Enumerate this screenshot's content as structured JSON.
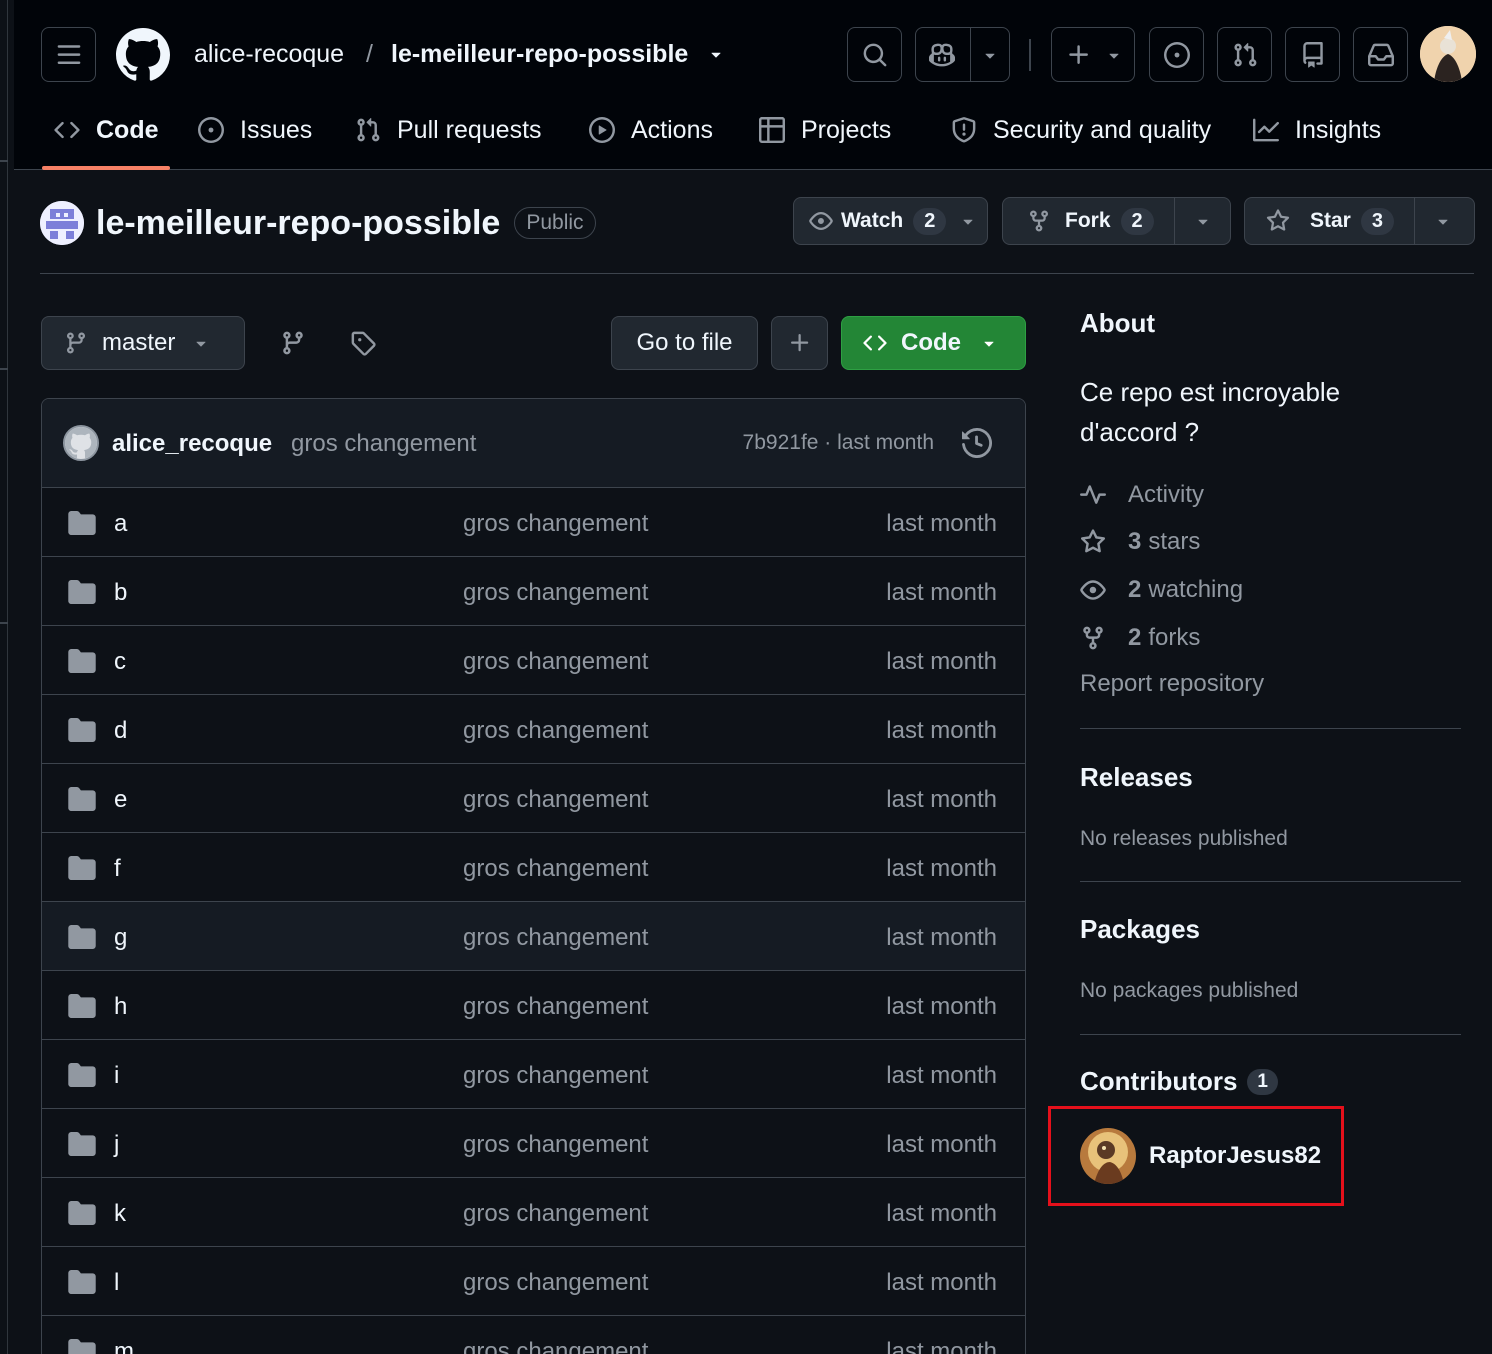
{
  "breadcrumb": {
    "owner": "alice-recoque",
    "separator": "/",
    "repo": "le-meilleur-repo-possible"
  },
  "tabs": [
    {
      "label": "Code",
      "icon": "code-icon",
      "active": true
    },
    {
      "label": "Issues",
      "icon": "issue-opened-icon"
    },
    {
      "label": "Pull requests",
      "icon": "git-pull-request-icon"
    },
    {
      "label": "Actions",
      "icon": "play-icon"
    },
    {
      "label": "Projects",
      "icon": "table-icon"
    },
    {
      "label": "Security and quality",
      "icon": "shield-icon"
    },
    {
      "label": "Insights",
      "icon": "graph-icon"
    }
  ],
  "repo": {
    "name": "le-meilleur-repo-possible",
    "visibility": "Public"
  },
  "actions": {
    "watch": {
      "label": "Watch",
      "count": "2"
    },
    "fork": {
      "label": "Fork",
      "count": "2"
    },
    "star": {
      "label": "Star",
      "count": "3"
    }
  },
  "toolbar": {
    "branch": "master",
    "goto_file": "Go to file",
    "code": "Code"
  },
  "commit": {
    "author": "alice_recoque",
    "message": "gros changement",
    "sha_time": "7b921fe · last month"
  },
  "files": [
    {
      "name": "a",
      "message": "gros changement",
      "time": "last month"
    },
    {
      "name": "b",
      "message": "gros changement",
      "time": "last month"
    },
    {
      "name": "c",
      "message": "gros changement",
      "time": "last month"
    },
    {
      "name": "d",
      "message": "gros changement",
      "time": "last month"
    },
    {
      "name": "e",
      "message": "gros changement",
      "time": "last month"
    },
    {
      "name": "f",
      "message": "gros changement",
      "time": "last month"
    },
    {
      "name": "g",
      "message": "gros changement",
      "time": "last month"
    },
    {
      "name": "h",
      "message": "gros changement",
      "time": "last month"
    },
    {
      "name": "i",
      "message": "gros changement",
      "time": "last month"
    },
    {
      "name": "j",
      "message": "gros changement",
      "time": "last month"
    },
    {
      "name": "k",
      "message": "gros changement",
      "time": "last month"
    },
    {
      "name": "l",
      "message": "gros changement",
      "time": "last month"
    },
    {
      "name": "m",
      "message": "gros changement",
      "time": "last month"
    }
  ],
  "about": {
    "heading": "About",
    "description": "Ce repo est incroyable d'accord ?",
    "activity": "Activity",
    "stars_count": "3",
    "stars_label": "stars",
    "watching_count": "2",
    "watching_label": "watching",
    "forks_count": "2",
    "forks_label": "forks",
    "report": "Report repository"
  },
  "releases": {
    "heading": "Releases",
    "empty": "No releases published"
  },
  "packages": {
    "heading": "Packages",
    "empty": "No packages published"
  },
  "contributors": {
    "heading": "Contributors",
    "count": "1",
    "user": "RaptorJesus82"
  },
  "colors": {
    "accent_underline": "#f78166",
    "code_button": "#238636",
    "highlight_box": "#e5101b"
  }
}
